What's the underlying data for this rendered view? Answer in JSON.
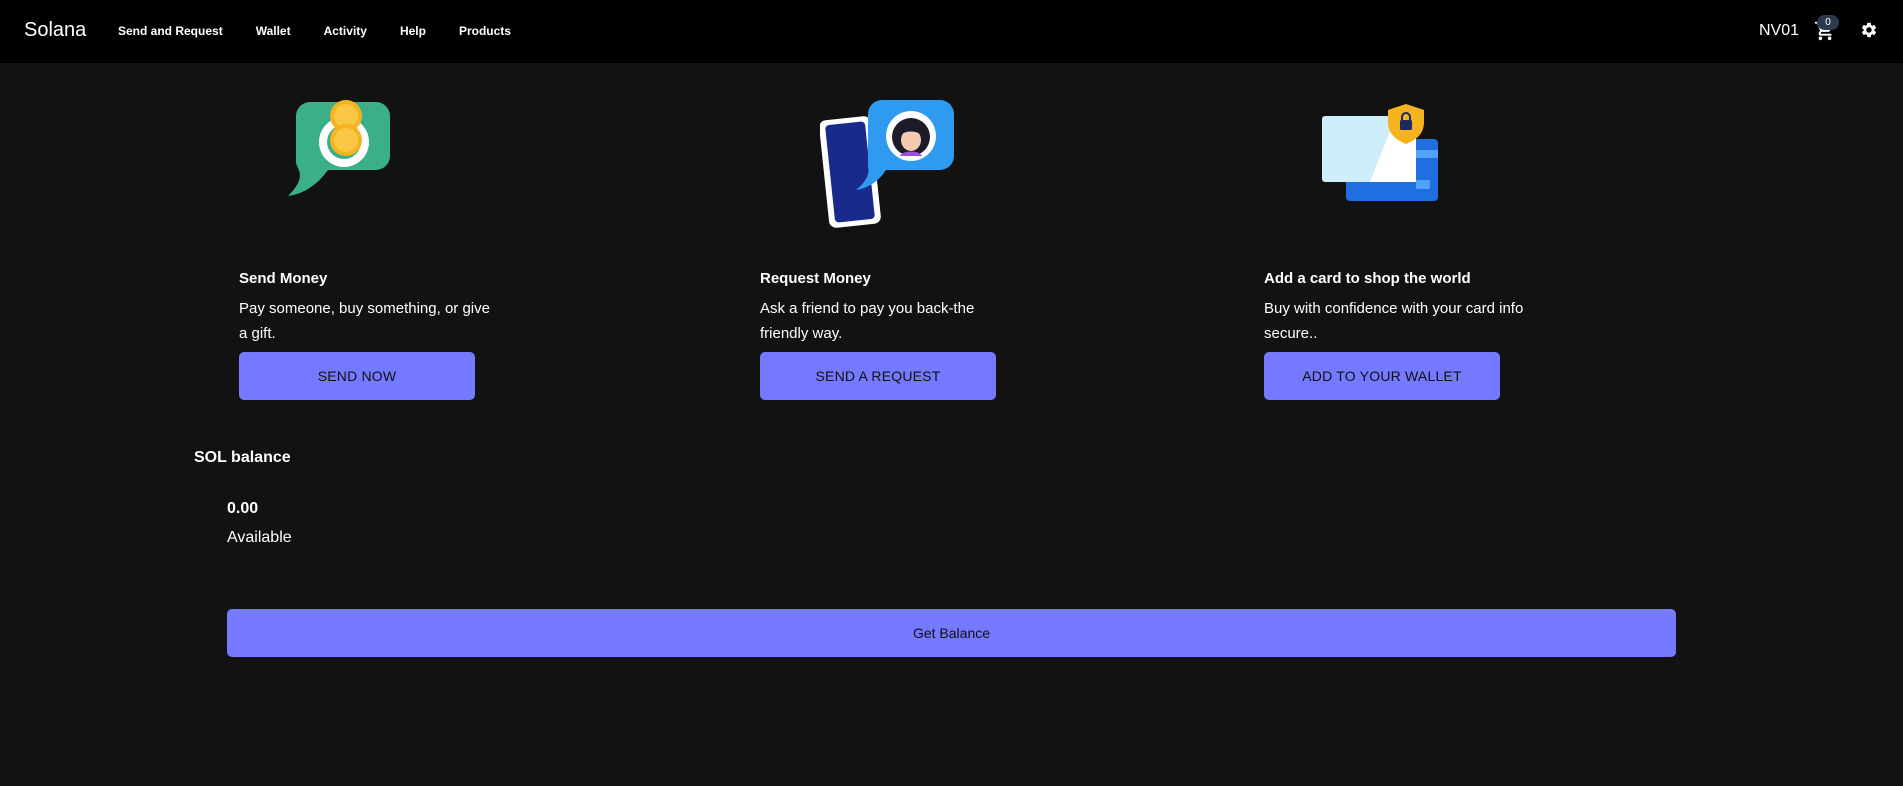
{
  "app": {
    "brand": "Solana"
  },
  "nav": {
    "links": [
      "Send and Request",
      "Wallet",
      "Activity",
      "Help",
      "Products"
    ],
    "user": "NV01",
    "cart_count": "0",
    "icons": {
      "cart": "cart-icon",
      "settings": "gear-icon"
    }
  },
  "features": [
    {
      "title": "Send Money",
      "description": "Pay someone, buy something, or give a gift.",
      "button": "SEND NOW",
      "icon": "coins-chat-icon"
    },
    {
      "title": "Request Money",
      "description": "Ask a friend to pay you back-the friendly way.",
      "button": "SEND A REQUEST",
      "icon": "phone-chat-icon"
    },
    {
      "title": "Add a card to shop the world",
      "description": "Buy with confidence with your card info secure..",
      "button": "ADD TO YOUR WALLET",
      "icon": "secure-card-icon"
    }
  ],
  "balance": {
    "title": "SOL balance",
    "value": "0.00",
    "label": "Available",
    "button": "Get Balance"
  },
  "colors": {
    "background": "#121212",
    "navbar": "#000000",
    "accent": "#7479ff"
  }
}
